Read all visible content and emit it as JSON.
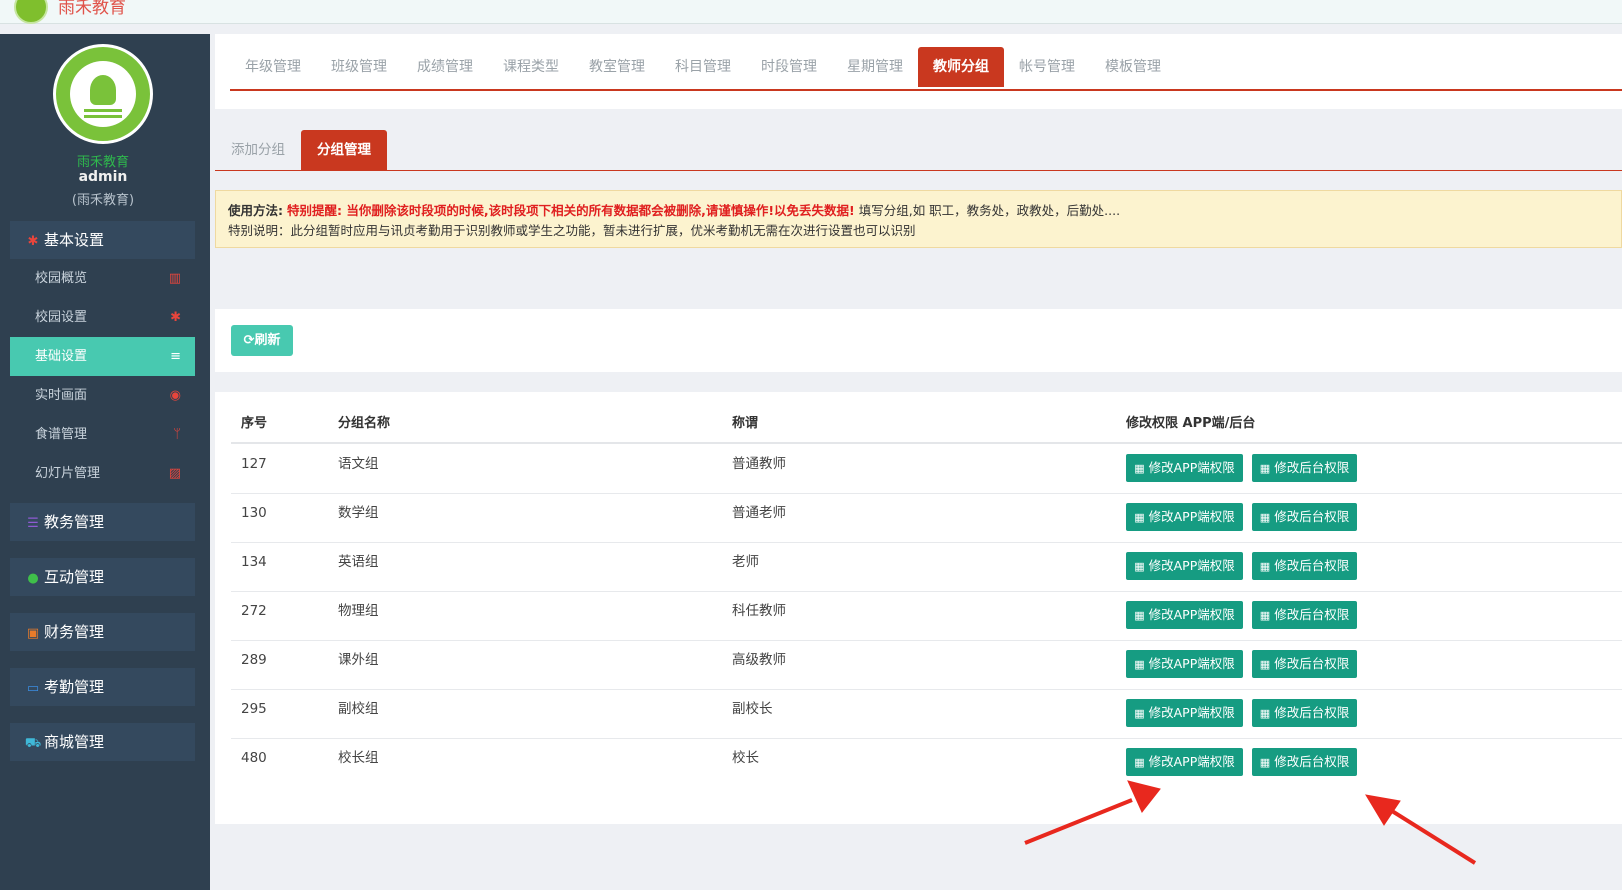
{
  "app": {
    "title": "雨禾教育"
  },
  "sidebar": {
    "brand_name": "雨禾教育",
    "user": "admin",
    "role": "(雨禾教育)",
    "groups": [
      {
        "label": "基本设置",
        "icon": "gear-icon",
        "items": [
          {
            "label": "校园概览",
            "icon": "bank-icon"
          },
          {
            "label": "校园设置",
            "icon": "gear-icon"
          },
          {
            "label": "基础设置",
            "icon": "list-icon",
            "active": true
          },
          {
            "label": "实时画面",
            "icon": "eye-icon"
          },
          {
            "label": "食谱管理",
            "icon": "cutlery-icon"
          },
          {
            "label": "幻灯片管理",
            "icon": "image-icon"
          }
        ]
      },
      {
        "label": "教务管理",
        "icon": "database-icon"
      },
      {
        "label": "互动管理",
        "icon": "wechat-icon"
      },
      {
        "label": "财务管理",
        "icon": "money-icon"
      },
      {
        "label": "考勤管理",
        "icon": "card-icon"
      },
      {
        "label": "商城管理",
        "icon": "cart-icon"
      }
    ]
  },
  "top_tabs": [
    "年级管理",
    "班级管理",
    "成绩管理",
    "课程类型",
    "教室管理",
    "科目管理",
    "时段管理",
    "星期管理",
    "教师分组",
    "帐号管理",
    "模板管理"
  ],
  "top_tabs_active": "教师分组",
  "sub_tabs": [
    "添加分组",
    "分组管理"
  ],
  "sub_tabs_active": "分组管理",
  "notice": {
    "label": "使用方法:",
    "warning": "特别提醒: 当你删除该时段项的时候,该时段项下相关的所有数据都会被删除,请谨慎操作!以免丢失数据!",
    "hint": "填写分组,如 职工，教务处，政教处，后勤处....",
    "line2": "特别说明：此分组暂时应用与讯贞考勤用于识别教师或学生之功能，暂未进行扩展，优米考勤机无需在次进行设置也可以识别"
  },
  "refresh_button": "刷新",
  "table": {
    "headers": {
      "id": "序号",
      "name": "分组名称",
      "title": "称谓",
      "actions": "修改权限 APP端/后台"
    },
    "app_btn": "修改APP端权限",
    "admin_btn": "修改后台权限",
    "rows": [
      {
        "id": "127",
        "name": "语文组",
        "title": "普通教师"
      },
      {
        "id": "130",
        "name": "数学组",
        "title": "普通老师"
      },
      {
        "id": "134",
        "name": "英语组",
        "title": "老师"
      },
      {
        "id": "272",
        "name": "物理组",
        "title": "科任教师"
      },
      {
        "id": "289",
        "name": "课外组",
        "title": "高级教师"
      },
      {
        "id": "295",
        "name": "副校组",
        "title": "副校长"
      },
      {
        "id": "480",
        "name": "校长组",
        "title": "校长"
      }
    ]
  },
  "colors": {
    "sidebar_bg": "#2f4050",
    "accent_red": "#c9381f",
    "teal": "#48c9b0",
    "action_green": "#169c82",
    "annotation_arrow": "#e8281e"
  }
}
